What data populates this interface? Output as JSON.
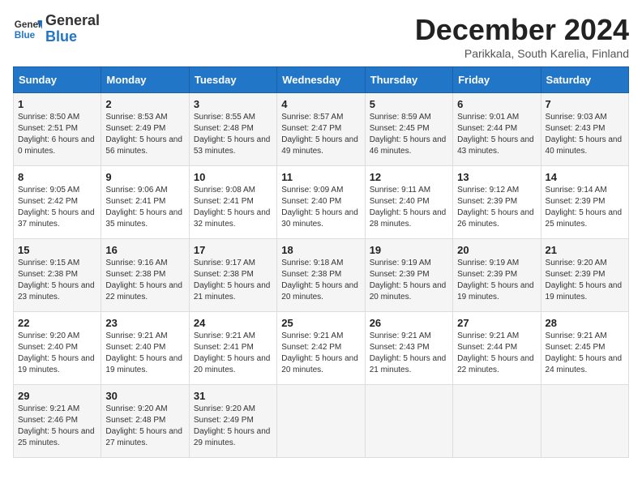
{
  "header": {
    "logo_general": "General",
    "logo_blue": "Blue",
    "month_title": "December 2024",
    "subtitle": "Parikkala, South Karelia, Finland"
  },
  "weekdays": [
    "Sunday",
    "Monday",
    "Tuesday",
    "Wednesday",
    "Thursday",
    "Friday",
    "Saturday"
  ],
  "weeks": [
    [
      {
        "day": "1",
        "sunrise": "8:50 AM",
        "sunset": "2:51 PM",
        "daylight": "6 hours and 0 minutes"
      },
      {
        "day": "2",
        "sunrise": "8:53 AM",
        "sunset": "2:49 PM",
        "daylight": "5 hours and 56 minutes"
      },
      {
        "day": "3",
        "sunrise": "8:55 AM",
        "sunset": "2:48 PM",
        "daylight": "5 hours and 53 minutes"
      },
      {
        "day": "4",
        "sunrise": "8:57 AM",
        "sunset": "2:47 PM",
        "daylight": "5 hours and 49 minutes"
      },
      {
        "day": "5",
        "sunrise": "8:59 AM",
        "sunset": "2:45 PM",
        "daylight": "5 hours and 46 minutes"
      },
      {
        "day": "6",
        "sunrise": "9:01 AM",
        "sunset": "2:44 PM",
        "daylight": "5 hours and 43 minutes"
      },
      {
        "day": "7",
        "sunrise": "9:03 AM",
        "sunset": "2:43 PM",
        "daylight": "5 hours and 40 minutes"
      }
    ],
    [
      {
        "day": "8",
        "sunrise": "9:05 AM",
        "sunset": "2:42 PM",
        "daylight": "5 hours and 37 minutes"
      },
      {
        "day": "9",
        "sunrise": "9:06 AM",
        "sunset": "2:41 PM",
        "daylight": "5 hours and 35 minutes"
      },
      {
        "day": "10",
        "sunrise": "9:08 AM",
        "sunset": "2:41 PM",
        "daylight": "5 hours and 32 minutes"
      },
      {
        "day": "11",
        "sunrise": "9:09 AM",
        "sunset": "2:40 PM",
        "daylight": "5 hours and 30 minutes"
      },
      {
        "day": "12",
        "sunrise": "9:11 AM",
        "sunset": "2:40 PM",
        "daylight": "5 hours and 28 minutes"
      },
      {
        "day": "13",
        "sunrise": "9:12 AM",
        "sunset": "2:39 PM",
        "daylight": "5 hours and 26 minutes"
      },
      {
        "day": "14",
        "sunrise": "9:14 AM",
        "sunset": "2:39 PM",
        "daylight": "5 hours and 25 minutes"
      }
    ],
    [
      {
        "day": "15",
        "sunrise": "9:15 AM",
        "sunset": "2:38 PM",
        "daylight": "5 hours and 23 minutes"
      },
      {
        "day": "16",
        "sunrise": "9:16 AM",
        "sunset": "2:38 PM",
        "daylight": "5 hours and 22 minutes"
      },
      {
        "day": "17",
        "sunrise": "9:17 AM",
        "sunset": "2:38 PM",
        "daylight": "5 hours and 21 minutes"
      },
      {
        "day": "18",
        "sunrise": "9:18 AM",
        "sunset": "2:38 PM",
        "daylight": "5 hours and 20 minutes"
      },
      {
        "day": "19",
        "sunrise": "9:19 AM",
        "sunset": "2:39 PM",
        "daylight": "5 hours and 20 minutes"
      },
      {
        "day": "20",
        "sunrise": "9:19 AM",
        "sunset": "2:39 PM",
        "daylight": "5 hours and 19 minutes"
      },
      {
        "day": "21",
        "sunrise": "9:20 AM",
        "sunset": "2:39 PM",
        "daylight": "5 hours and 19 minutes"
      }
    ],
    [
      {
        "day": "22",
        "sunrise": "9:20 AM",
        "sunset": "2:40 PM",
        "daylight": "5 hours and 19 minutes"
      },
      {
        "day": "23",
        "sunrise": "9:21 AM",
        "sunset": "2:40 PM",
        "daylight": "5 hours and 19 minutes"
      },
      {
        "day": "24",
        "sunrise": "9:21 AM",
        "sunset": "2:41 PM",
        "daylight": "5 hours and 20 minutes"
      },
      {
        "day": "25",
        "sunrise": "9:21 AM",
        "sunset": "2:42 PM",
        "daylight": "5 hours and 20 minutes"
      },
      {
        "day": "26",
        "sunrise": "9:21 AM",
        "sunset": "2:43 PM",
        "daylight": "5 hours and 21 minutes"
      },
      {
        "day": "27",
        "sunrise": "9:21 AM",
        "sunset": "2:44 PM",
        "daylight": "5 hours and 22 minutes"
      },
      {
        "day": "28",
        "sunrise": "9:21 AM",
        "sunset": "2:45 PM",
        "daylight": "5 hours and 24 minutes"
      }
    ],
    [
      {
        "day": "29",
        "sunrise": "9:21 AM",
        "sunset": "2:46 PM",
        "daylight": "5 hours and 25 minutes"
      },
      {
        "day": "30",
        "sunrise": "9:20 AM",
        "sunset": "2:48 PM",
        "daylight": "5 hours and 27 minutes"
      },
      {
        "day": "31",
        "sunrise": "9:20 AM",
        "sunset": "2:49 PM",
        "daylight": "5 hours and 29 minutes"
      },
      null,
      null,
      null,
      null
    ]
  ],
  "labels": {
    "sunrise": "Sunrise:",
    "sunset": "Sunset:",
    "daylight": "Daylight:"
  }
}
